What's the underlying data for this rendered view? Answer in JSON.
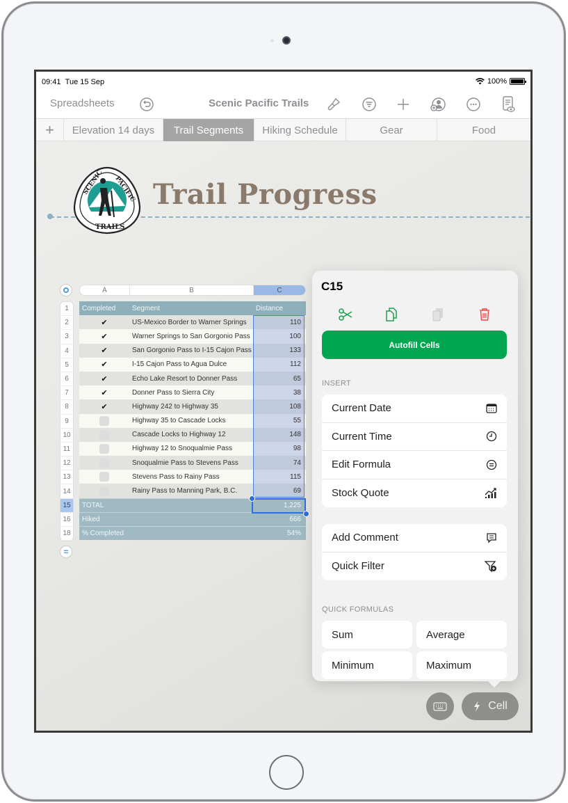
{
  "status_bar": {
    "time": "09:41",
    "date": "Tue 15 Sep",
    "battery": "100%"
  },
  "toolbar": {
    "back_label": "Spreadsheets",
    "document_title": "Scenic Pacific Trails",
    "icons": [
      "undo-icon",
      "format-brush-icon",
      "organize-icon",
      "add-icon",
      "collaborate-icon",
      "more-icon",
      "view-options-icon"
    ]
  },
  "tabs": [
    {
      "label": "+"
    },
    {
      "label": "Elevation 14 days"
    },
    {
      "label": "Trail Segments",
      "active": true
    },
    {
      "label": "Hiking Schedule"
    },
    {
      "label": "Gear"
    },
    {
      "label": "Food"
    }
  ],
  "page": {
    "title": "Trail Progress",
    "logo": {
      "top_left": "SCENIC",
      "top_right": "PACIFIC",
      "bottom": "TRAILS"
    }
  },
  "table": {
    "column_letters": [
      "A",
      "B",
      "C"
    ],
    "selected_column": "C",
    "row_numbers": [
      "1",
      "2",
      "3",
      "4",
      "5",
      "6",
      "7",
      "8",
      "9",
      "10",
      "11",
      "12",
      "13",
      "14",
      "15",
      "16",
      "18"
    ],
    "headers": [
      "Completed",
      "Segment",
      "Distance"
    ],
    "rows": [
      {
        "completed": true,
        "segment": "US-Mexico Border to Warner Springs",
        "distance": "110"
      },
      {
        "completed": true,
        "segment": "Warner Springs to San Gorgonio Pass",
        "distance": "100"
      },
      {
        "completed": true,
        "segment": "San Gorgonio Pass to I-15 Cajon Pass",
        "distance": "133"
      },
      {
        "completed": true,
        "segment": "I-15 Cajon Pass to Agua Dulce",
        "distance": "112"
      },
      {
        "completed": true,
        "segment": "Echo Lake Resort to Donner Pass",
        "distance": "65"
      },
      {
        "completed": true,
        "segment": "Donner Pass to Sierra City",
        "distance": "38"
      },
      {
        "completed": true,
        "segment": "Highway 242 to Highway 35",
        "distance": "108"
      },
      {
        "completed": false,
        "segment": "Highway 35 to Cascade Locks",
        "distance": "55"
      },
      {
        "completed": false,
        "segment": "Cascade Locks to Highway 12",
        "distance": "148"
      },
      {
        "completed": false,
        "segment": "Highway 12 to Snoqualmie Pass",
        "distance": "98"
      },
      {
        "completed": false,
        "segment": "Snoqualmie Pass to Stevens Pass",
        "distance": "74"
      },
      {
        "completed": false,
        "segment": "Stevens Pass to Rainy Pass",
        "distance": "115"
      },
      {
        "completed": false,
        "segment": "Rainy Pass to Manning Park, B.C.",
        "distance": "69"
      }
    ],
    "footer": [
      {
        "label": "TOTAL",
        "value": "1,225"
      },
      {
        "label": "Hiked",
        "value": "666"
      },
      {
        "label": "% Completed",
        "value": "54%"
      }
    ],
    "selected_cell": "C15"
  },
  "popover": {
    "cell_ref": "C15",
    "actions": [
      "cut-icon",
      "copy-icon",
      "paste-icon",
      "delete-icon"
    ],
    "autofill_label": "Autofill Cells",
    "insert_label": "INSERT",
    "insert_items": [
      {
        "label": "Current Date",
        "icon": "calendar-icon"
      },
      {
        "label": "Current Time",
        "icon": "clock-icon"
      },
      {
        "label": "Edit Formula",
        "icon": "formula-icon"
      },
      {
        "label": "Stock Quote",
        "icon": "stock-chart-icon"
      }
    ],
    "other_items": [
      {
        "label": "Add Comment",
        "icon": "comment-icon"
      },
      {
        "label": "Quick Filter",
        "icon": "filter-icon"
      }
    ],
    "quick_formulas_label": "QUICK FORMULAS",
    "quick_formulas": [
      "Sum",
      "Average",
      "Minimum",
      "Maximum"
    ]
  },
  "bottom_controls": {
    "keyboard_icon": "keyboard-icon",
    "cell_label": "Cell"
  },
  "colors": {
    "accent_green": "#00a650",
    "delete_red": "#f04848",
    "selection_blue": "#2f6fd8",
    "table_header": "#8fb0bb",
    "title_brown": "#8a7a6c"
  }
}
